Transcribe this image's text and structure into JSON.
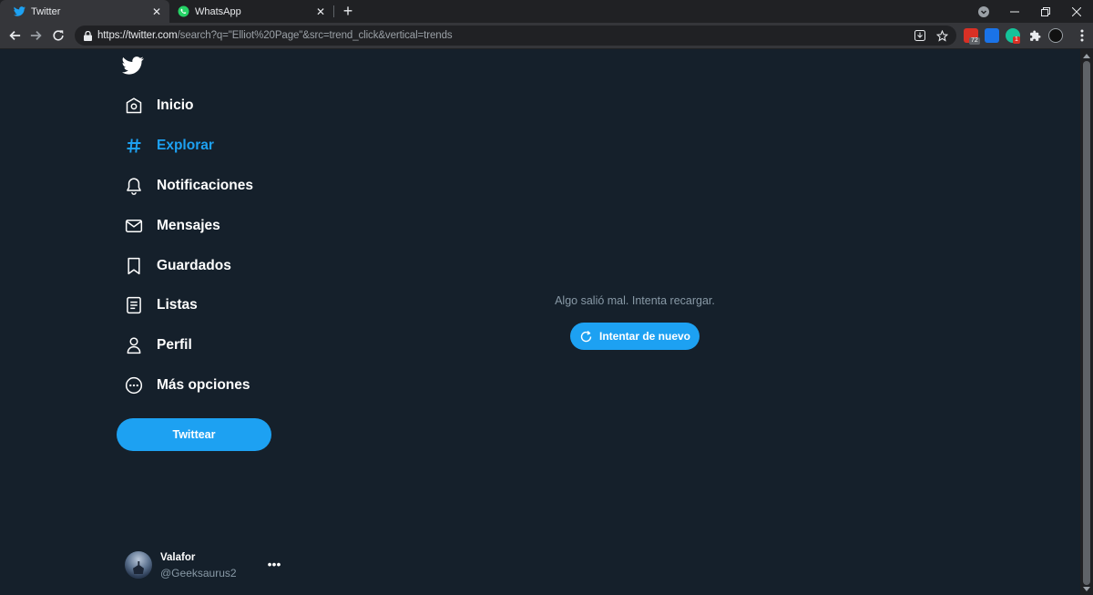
{
  "browser": {
    "tabs": [
      {
        "title": "Twitter",
        "icon": "twitter-bird-icon",
        "active": true
      },
      {
        "title": "WhatsApp",
        "icon": "whatsapp-icon",
        "active": false
      }
    ],
    "url_host": "https://twitter.com",
    "url_rest": "/search?q=\"Elliot%20Page\"&src=trend_click&vertical=trends",
    "extensions": [
      {
        "name": "ext-red-icon",
        "badge": "72",
        "color": "#d93025"
      },
      {
        "name": "ext-blue-icon",
        "badge": "",
        "color": "#1a73e8"
      },
      {
        "name": "ext-grammarly-icon",
        "badge": "1",
        "color": "#15c39a"
      }
    ]
  },
  "sidebar": {
    "items": [
      {
        "label": "Inicio",
        "icon": "home-icon"
      },
      {
        "label": "Explorar",
        "icon": "hashtag-icon",
        "active": true
      },
      {
        "label": "Notificaciones",
        "icon": "bell-icon"
      },
      {
        "label": "Mensajes",
        "icon": "mail-icon"
      },
      {
        "label": "Guardados",
        "icon": "bookmark-icon"
      },
      {
        "label": "Listas",
        "icon": "list-icon"
      },
      {
        "label": "Perfil",
        "icon": "person-icon"
      },
      {
        "label": "Más opciones",
        "icon": "more-circle-icon"
      }
    ],
    "tweet_button": "Twittear"
  },
  "account": {
    "name": "Valafor",
    "handle": "@Geeksaurus2",
    "more": "•••"
  },
  "main": {
    "error_message": "Algo salió mal. Intenta recargar.",
    "retry_button": "Intentar de nuevo"
  },
  "colors": {
    "background": "#15202b",
    "accent": "#1da1f2",
    "secondary_text": "#8899a6"
  }
}
